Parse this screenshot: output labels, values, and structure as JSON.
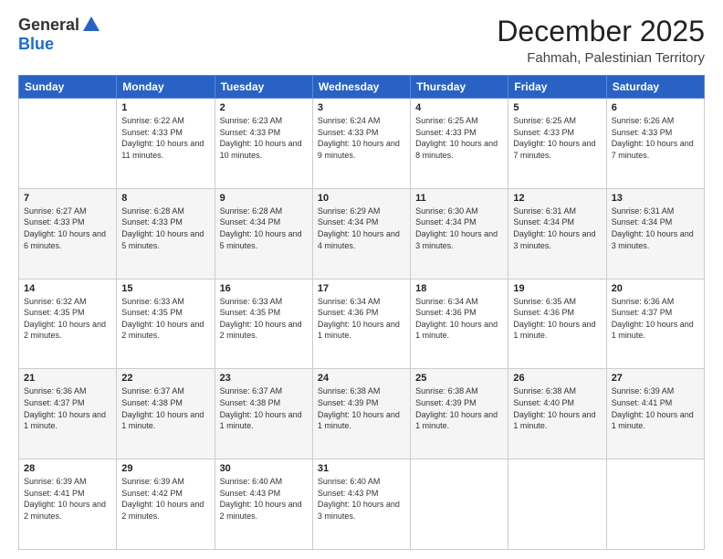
{
  "logo": {
    "general": "General",
    "blue": "Blue"
  },
  "title": {
    "month": "December 2025",
    "location": "Fahmah, Palestinian Territory"
  },
  "days_header": [
    "Sunday",
    "Monday",
    "Tuesday",
    "Wednesday",
    "Thursday",
    "Friday",
    "Saturday"
  ],
  "weeks": [
    [
      {
        "day": "",
        "sunrise": "",
        "sunset": "",
        "daylight": ""
      },
      {
        "day": "1",
        "sunrise": "Sunrise: 6:22 AM",
        "sunset": "Sunset: 4:33 PM",
        "daylight": "Daylight: 10 hours and 11 minutes."
      },
      {
        "day": "2",
        "sunrise": "Sunrise: 6:23 AM",
        "sunset": "Sunset: 4:33 PM",
        "daylight": "Daylight: 10 hours and 10 minutes."
      },
      {
        "day": "3",
        "sunrise": "Sunrise: 6:24 AM",
        "sunset": "Sunset: 4:33 PM",
        "daylight": "Daylight: 10 hours and 9 minutes."
      },
      {
        "day": "4",
        "sunrise": "Sunrise: 6:25 AM",
        "sunset": "Sunset: 4:33 PM",
        "daylight": "Daylight: 10 hours and 8 minutes."
      },
      {
        "day": "5",
        "sunrise": "Sunrise: 6:25 AM",
        "sunset": "Sunset: 4:33 PM",
        "daylight": "Daylight: 10 hours and 7 minutes."
      },
      {
        "day": "6",
        "sunrise": "Sunrise: 6:26 AM",
        "sunset": "Sunset: 4:33 PM",
        "daylight": "Daylight: 10 hours and 7 minutes."
      }
    ],
    [
      {
        "day": "7",
        "sunrise": "Sunrise: 6:27 AM",
        "sunset": "Sunset: 4:33 PM",
        "daylight": "Daylight: 10 hours and 6 minutes."
      },
      {
        "day": "8",
        "sunrise": "Sunrise: 6:28 AM",
        "sunset": "Sunset: 4:33 PM",
        "daylight": "Daylight: 10 hours and 5 minutes."
      },
      {
        "day": "9",
        "sunrise": "Sunrise: 6:28 AM",
        "sunset": "Sunset: 4:34 PM",
        "daylight": "Daylight: 10 hours and 5 minutes."
      },
      {
        "day": "10",
        "sunrise": "Sunrise: 6:29 AM",
        "sunset": "Sunset: 4:34 PM",
        "daylight": "Daylight: 10 hours and 4 minutes."
      },
      {
        "day": "11",
        "sunrise": "Sunrise: 6:30 AM",
        "sunset": "Sunset: 4:34 PM",
        "daylight": "Daylight: 10 hours and 3 minutes."
      },
      {
        "day": "12",
        "sunrise": "Sunrise: 6:31 AM",
        "sunset": "Sunset: 4:34 PM",
        "daylight": "Daylight: 10 hours and 3 minutes."
      },
      {
        "day": "13",
        "sunrise": "Sunrise: 6:31 AM",
        "sunset": "Sunset: 4:34 PM",
        "daylight": "Daylight: 10 hours and 3 minutes."
      }
    ],
    [
      {
        "day": "14",
        "sunrise": "Sunrise: 6:32 AM",
        "sunset": "Sunset: 4:35 PM",
        "daylight": "Daylight: 10 hours and 2 minutes."
      },
      {
        "day": "15",
        "sunrise": "Sunrise: 6:33 AM",
        "sunset": "Sunset: 4:35 PM",
        "daylight": "Daylight: 10 hours and 2 minutes."
      },
      {
        "day": "16",
        "sunrise": "Sunrise: 6:33 AM",
        "sunset": "Sunset: 4:35 PM",
        "daylight": "Daylight: 10 hours and 2 minutes."
      },
      {
        "day": "17",
        "sunrise": "Sunrise: 6:34 AM",
        "sunset": "Sunset: 4:36 PM",
        "daylight": "Daylight: 10 hours and 1 minute."
      },
      {
        "day": "18",
        "sunrise": "Sunrise: 6:34 AM",
        "sunset": "Sunset: 4:36 PM",
        "daylight": "Daylight: 10 hours and 1 minute."
      },
      {
        "day": "19",
        "sunrise": "Sunrise: 6:35 AM",
        "sunset": "Sunset: 4:36 PM",
        "daylight": "Daylight: 10 hours and 1 minute."
      },
      {
        "day": "20",
        "sunrise": "Sunrise: 6:36 AM",
        "sunset": "Sunset: 4:37 PM",
        "daylight": "Daylight: 10 hours and 1 minute."
      }
    ],
    [
      {
        "day": "21",
        "sunrise": "Sunrise: 6:36 AM",
        "sunset": "Sunset: 4:37 PM",
        "daylight": "Daylight: 10 hours and 1 minute."
      },
      {
        "day": "22",
        "sunrise": "Sunrise: 6:37 AM",
        "sunset": "Sunset: 4:38 PM",
        "daylight": "Daylight: 10 hours and 1 minute."
      },
      {
        "day": "23",
        "sunrise": "Sunrise: 6:37 AM",
        "sunset": "Sunset: 4:38 PM",
        "daylight": "Daylight: 10 hours and 1 minute."
      },
      {
        "day": "24",
        "sunrise": "Sunrise: 6:38 AM",
        "sunset": "Sunset: 4:39 PM",
        "daylight": "Daylight: 10 hours and 1 minute."
      },
      {
        "day": "25",
        "sunrise": "Sunrise: 6:38 AM",
        "sunset": "Sunset: 4:39 PM",
        "daylight": "Daylight: 10 hours and 1 minute."
      },
      {
        "day": "26",
        "sunrise": "Sunrise: 6:38 AM",
        "sunset": "Sunset: 4:40 PM",
        "daylight": "Daylight: 10 hours and 1 minute."
      },
      {
        "day": "27",
        "sunrise": "Sunrise: 6:39 AM",
        "sunset": "Sunset: 4:41 PM",
        "daylight": "Daylight: 10 hours and 1 minute."
      }
    ],
    [
      {
        "day": "28",
        "sunrise": "Sunrise: 6:39 AM",
        "sunset": "Sunset: 4:41 PM",
        "daylight": "Daylight: 10 hours and 2 minutes."
      },
      {
        "day": "29",
        "sunrise": "Sunrise: 6:39 AM",
        "sunset": "Sunset: 4:42 PM",
        "daylight": "Daylight: 10 hours and 2 minutes."
      },
      {
        "day": "30",
        "sunrise": "Sunrise: 6:40 AM",
        "sunset": "Sunset: 4:43 PM",
        "daylight": "Daylight: 10 hours and 2 minutes."
      },
      {
        "day": "31",
        "sunrise": "Sunrise: 6:40 AM",
        "sunset": "Sunset: 4:43 PM",
        "daylight": "Daylight: 10 hours and 3 minutes."
      },
      {
        "day": "",
        "sunrise": "",
        "sunset": "",
        "daylight": ""
      },
      {
        "day": "",
        "sunrise": "",
        "sunset": "",
        "daylight": ""
      },
      {
        "day": "",
        "sunrise": "",
        "sunset": "",
        "daylight": ""
      }
    ]
  ]
}
